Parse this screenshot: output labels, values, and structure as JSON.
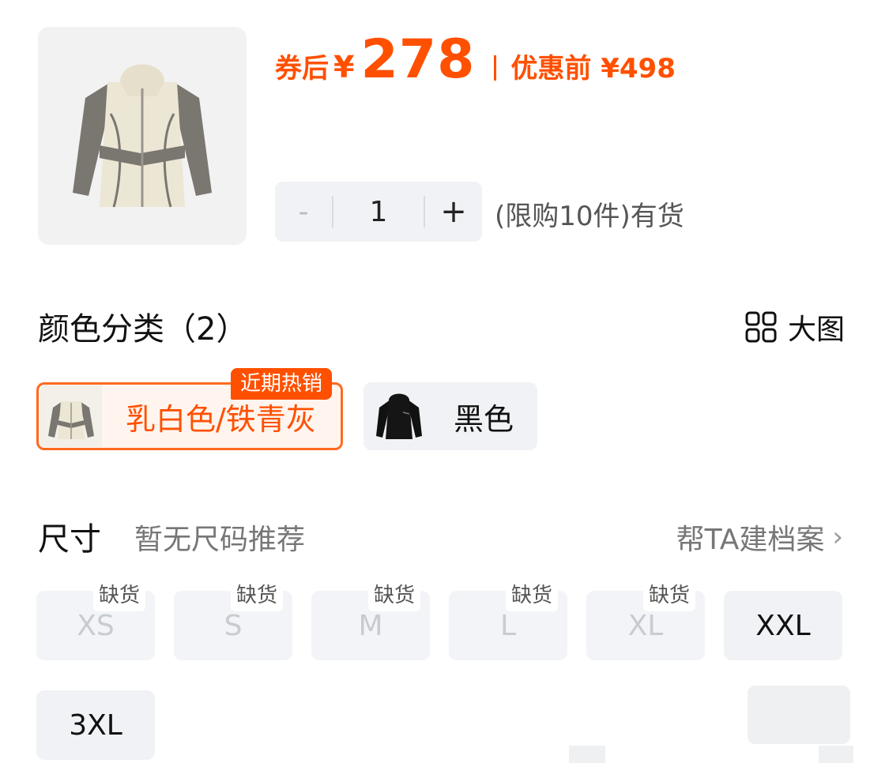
{
  "price": {
    "label": "券后",
    "currency": "¥",
    "value": "278",
    "original": "优惠前 ¥498",
    "color": "#ff5000"
  },
  "quantity": {
    "minus": "-",
    "value": "1",
    "plus": "+",
    "note": "(限购10件)有货"
  },
  "color_section": {
    "title": "颜色分类（2）",
    "big_view_label": "大图",
    "big_view_icon": "grid-icon",
    "options": [
      {
        "label": "乳白色/铁青灰",
        "badge": "近期热销",
        "selected": true
      },
      {
        "label": "黑色",
        "selected": false
      }
    ]
  },
  "size_section": {
    "title": "尺寸",
    "hint": "暂无尺码推荐",
    "link": "帮TA建档案",
    "link_icon": "chevron-right-icon",
    "out_of_stock_label": "缺货",
    "sizes": [
      {
        "label": "XS",
        "available": false
      },
      {
        "label": "S",
        "available": false
      },
      {
        "label": "M",
        "available": false
      },
      {
        "label": "L",
        "available": false
      },
      {
        "label": "XL",
        "available": false
      },
      {
        "label": "XXL",
        "available": true
      },
      {
        "label": "3XL",
        "available": true
      }
    ]
  }
}
